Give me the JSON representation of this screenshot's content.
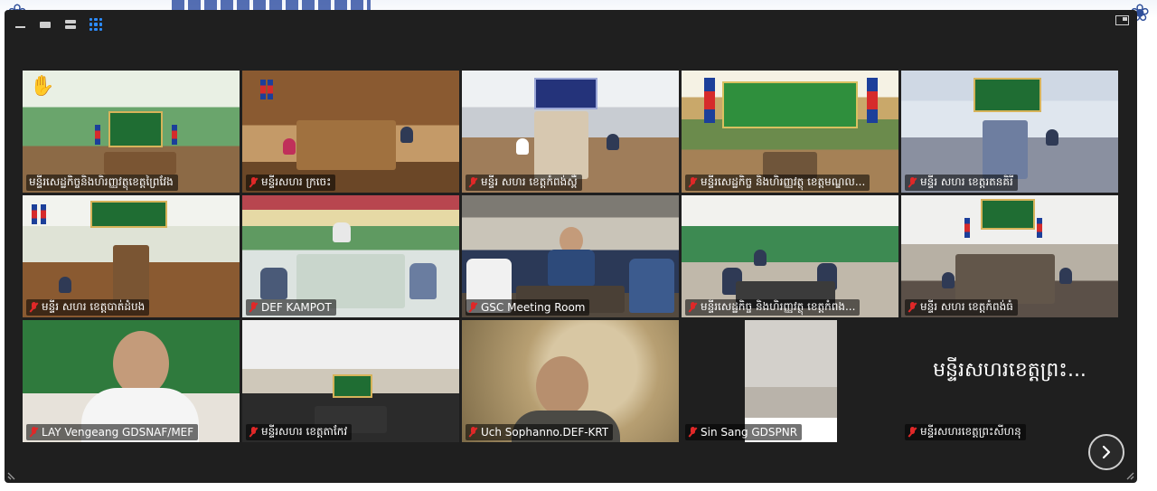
{
  "toolbar": {
    "icons": [
      "minimize-icon",
      "single-view-icon",
      "split-view-icon",
      "gallery-view-icon"
    ],
    "active_view": "gallery-view-icon",
    "active_color": "#2d8cff"
  },
  "tiles": [
    {
      "label": "មន្ទីរសេដ្ឋកិច្ចនិងហិរញ្ញវត្ថុខេត្តព្រៃវែង",
      "muted": false,
      "hand_raised": true,
      "active_speaker": true
    },
    {
      "label": "មន្ទីរសហរ ក្រចេះ",
      "muted": true
    },
    {
      "label": "មន្ទីរ សហរ ខេត្តកំពង់ស្ពឺ",
      "muted": true
    },
    {
      "label": "មន្ទីរសេដ្ឋកិច្ច និងហិរញ្ញវត្ថុ ខេត្តមណ្ឌល...",
      "muted": true
    },
    {
      "label": "មន្ទីរ សហរ ខេត្តរតនគិរី",
      "muted": true
    },
    {
      "label": "មន្ទីរ សហរ ខេត្តបាត់ដំបង",
      "muted": true
    },
    {
      "label": "DEF KAMPOT",
      "muted": true
    },
    {
      "label": "GSC Meeting Room",
      "muted": true
    },
    {
      "label": "មន្ទីរសេដ្ឋកិច្ច និងហិរញ្ញវត្ថុ ខេត្តកំពង...",
      "muted": true
    },
    {
      "label": "មន្ទីរ សហរ ខេត្តកំពង់ធំ",
      "muted": true
    },
    {
      "label": "LAY Vengeang GDSNAF/MEF",
      "muted": true
    },
    {
      "label": "មន្ទីរសហរ ខេត្តតាកែវ",
      "muted": true
    },
    {
      "label": "Uch Sophanno.DEF-KRT",
      "muted": true
    },
    {
      "label": "Sin Sang GDSPNR",
      "muted": true
    },
    {
      "label": "មន្ទីរសហរខេត្តព្រះសីហនុ",
      "muted": true,
      "display_name": "មន្ទីរសហរខេត្តព្រះ..."
    }
  ],
  "colors": {
    "window_bg": "#1f1f1f",
    "active_speaker_border": "#d8dc3c",
    "muted_mic": "#e02828",
    "raise_hand": "#f7b500"
  }
}
